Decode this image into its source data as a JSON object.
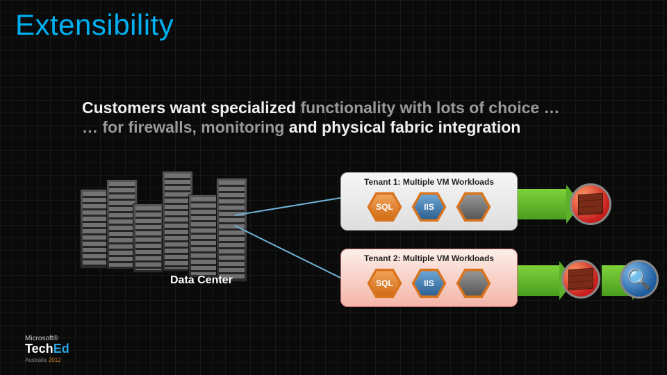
{
  "title": "Extensibility",
  "subtitle_line1_a": "Customers want specialized ",
  "subtitle_line1_b": "functionality with lots of choice …",
  "subtitle_line2_a": "… for firewalls, monitoring ",
  "subtitle_line2_b": "and physical fabric integration",
  "datacenter_label": "Data Center",
  "tenants": [
    {
      "label": "Tenant 1: Multiple VM Workloads",
      "hex": [
        "SQL",
        "IIS",
        ""
      ]
    },
    {
      "label": "Tenant 2: Multiple VM Workloads",
      "hex": [
        "SQL",
        "IIS",
        ""
      ]
    }
  ],
  "ext_icons": {
    "firewall": "firewall",
    "monitor_glyph": "🔍"
  },
  "footer": {
    "ms": "Microsoft®",
    "brand_a": "Tech",
    "brand_b": "Ed",
    "region": "Australia",
    "year": "2012"
  }
}
